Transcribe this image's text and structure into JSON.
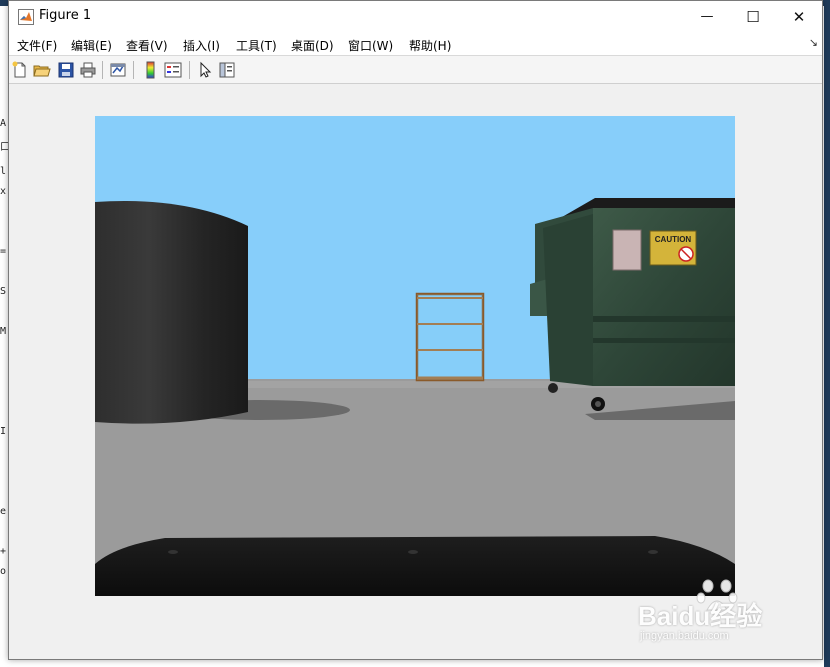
{
  "window": {
    "title": "Figure 1",
    "controls": {
      "minimize": "—",
      "maximize": "☐",
      "close": "✕"
    }
  },
  "menu": {
    "items": [
      "文件(F)",
      "编辑(E)",
      "查看(V)",
      "插入(I)",
      "工具(T)",
      "桌面(D)",
      "窗口(W)",
      "帮助(H)"
    ],
    "expand": "↘"
  },
  "toolbar": {
    "buttons": [
      "new-figure-icon",
      "open-file-icon",
      "save-icon",
      "print-icon",
      "link-plot-icon",
      "colorbar-icon",
      "legend-icon",
      "pointer-icon",
      "property-editor-icon"
    ]
  },
  "scene": {
    "sky_color": "#87cefa",
    "ground_color": "#9a9a9a",
    "dumpster_sign": "CAUTION"
  },
  "background_left_chars": [
    "A",
    "口",
    "l",
    "x",
    "=",
    "S",
    "M",
    "I",
    "e",
    "+",
    "o"
  ],
  "watermark": {
    "brand": "Baidu经验",
    "url": "jingyan.baidu.com"
  }
}
